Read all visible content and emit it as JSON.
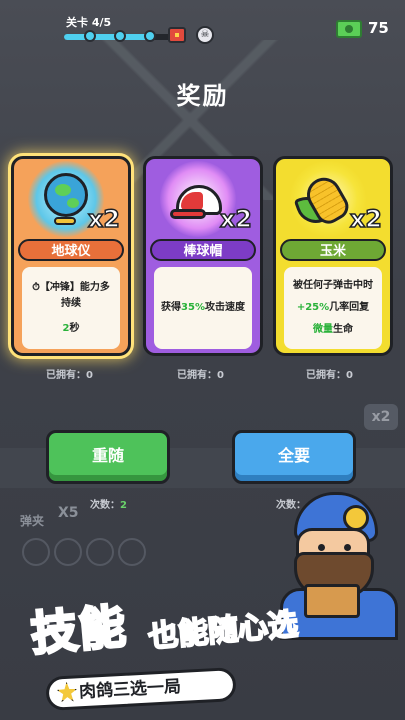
{
  "hud": {
    "level_label": "关卡 4/5",
    "level_progress": 0.8,
    "cash": "75"
  },
  "title": "奖励",
  "cards": [
    {
      "name": "地球仪",
      "count": "x2",
      "desc_prefix": "⏱【冲锋】能力多持续",
      "desc_value": "2",
      "desc_suffix": "秒",
      "owned": "已拥有：0",
      "rarity_color": "#f5a25a"
    },
    {
      "name": "棒球帽",
      "count": "x2",
      "desc_prefix": "获得",
      "desc_value": "35%",
      "desc_suffix": "攻击速度",
      "owned": "已拥有：0",
      "rarity_color": "#9f5de0"
    },
    {
      "name": "玉米",
      "count": "x2",
      "desc_prefix": "被任何子弹击中时",
      "desc_value": "+25%",
      "desc_mid": "几率回复",
      "desc_value2": "微量",
      "desc_suffix": "生命",
      "owned": "已拥有：0",
      "rarity_color": "#f3dd2f"
    }
  ],
  "buttons": {
    "reroll_label": "重随",
    "reroll_times_label": "次数：",
    "reroll_times": "2",
    "take_all_label": "全要",
    "take_all_times_label": "次数："
  },
  "background": {
    "x2_label": "x2",
    "slingshot_label": "弹夹",
    "x5_label": "X5"
  },
  "promo": {
    "headline_big": "技能",
    "headline_small": "也能随心选",
    "tagline": "肉鸽三选一局"
  },
  "colors": {
    "accent_green": "#4ec25a",
    "accent_blue": "#4aa8ec",
    "highlight_green": "#2ab23a"
  }
}
